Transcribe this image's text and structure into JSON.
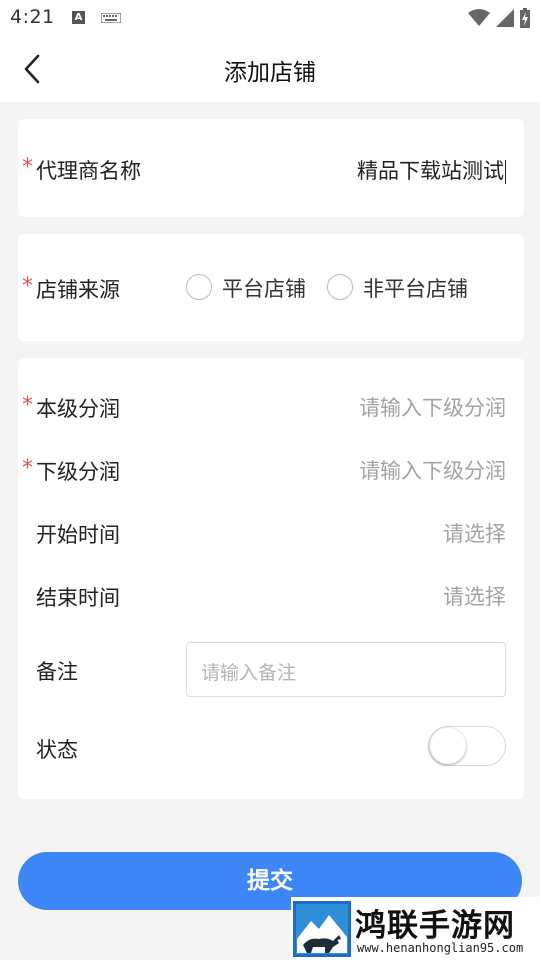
{
  "status_bar": {
    "time": "4:21",
    "icons": [
      "a-badge-icon",
      "keyboard-icon",
      "wifi-icon",
      "signal-icon",
      "battery-charging-icon"
    ]
  },
  "header": {
    "title": "添加店铺",
    "back_icon": "chevron-left-icon"
  },
  "form": {
    "agent_name": {
      "required_mark": "*",
      "label": "代理商名称",
      "value": "精品下载站测试"
    },
    "store_source": {
      "required_mark": "*",
      "label": "店铺来源",
      "options": [
        "平台店铺",
        "非平台店铺"
      ],
      "selected": null
    },
    "own_share": {
      "required_mark": "*",
      "label": "本级分润",
      "placeholder": "请输入下级分润"
    },
    "sub_share": {
      "required_mark": "*",
      "label": "下级分润",
      "placeholder": "请输入下级分润"
    },
    "start_time": {
      "label": "开始时间",
      "placeholder": "请选择"
    },
    "end_time": {
      "label": "结束时间",
      "placeholder": "请选择"
    },
    "remark": {
      "label": "备注",
      "placeholder": "请输入备注"
    },
    "status": {
      "label": "状态",
      "enabled": false
    }
  },
  "submit": {
    "label": "提交"
  },
  "watermark": {
    "title": "鸿联手游网",
    "url": "www.henanhonglian95.com"
  },
  "colors": {
    "primary": "#3d86f7",
    "required": "#e05555",
    "placeholder": "#a3a3a3",
    "background": "#f4f4f4"
  }
}
